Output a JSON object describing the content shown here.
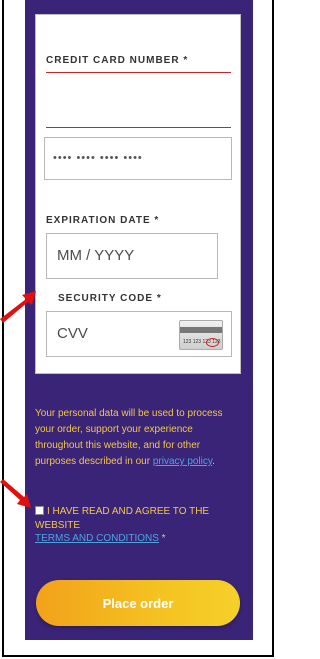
{
  "form": {
    "cc_label": "CREDIT CARD NUMBER *",
    "cc_placeholder": "•••• •••• •••• ••••",
    "exp_label": "EXPIRATION DATE *",
    "exp_placeholder": "MM / YYYY",
    "sec_label": "SECURITY CODE *",
    "cvv_placeholder": "CVV",
    "card_icon_digits": "123 123 123 123"
  },
  "notice": {
    "text": "Your personal data will be used to process your order, support your experience throughout this website, and for other purposes described in our ",
    "link": "privacy policy",
    "suffix": "."
  },
  "agree": {
    "text": "I HAVE READ AND AGREE TO THE WEBSITE",
    "terms_link": "TERMS AND CONDITIONS",
    "required": " *"
  },
  "button": {
    "label": "Place order"
  },
  "colors": {
    "panel": "#3a2477",
    "accent_yellow": "#f3c74a",
    "link": "#4fa4e0",
    "required_red": "#c3272d",
    "annotation_red": "#e01010"
  }
}
